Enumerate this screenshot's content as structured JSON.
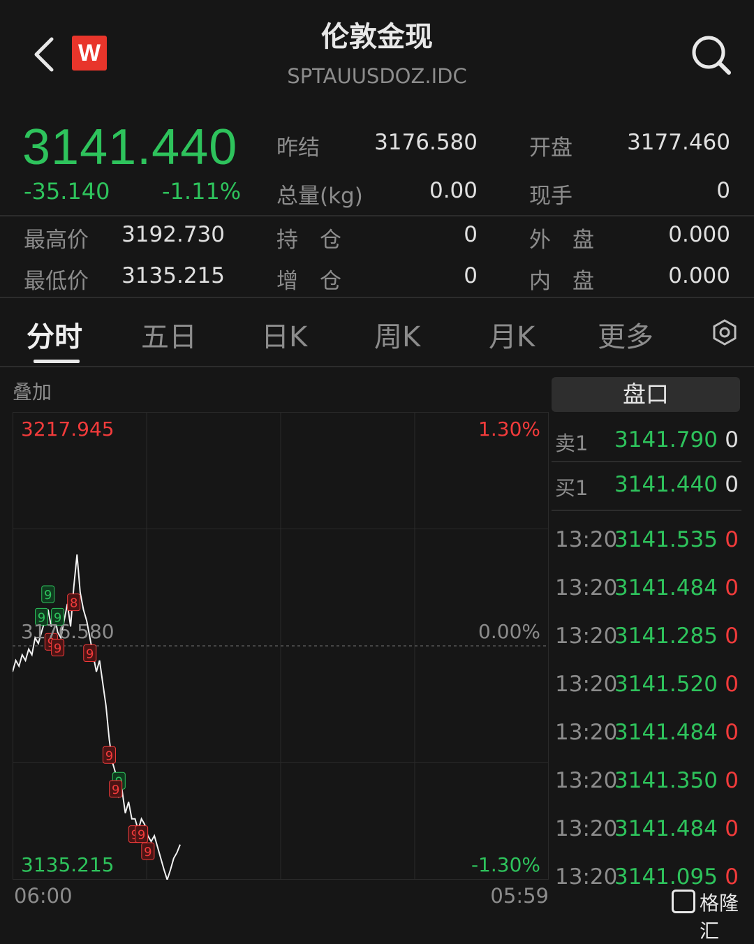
{
  "header": {
    "title": "伦敦金现",
    "code": "SPTAUUSDOZ.IDC",
    "logo_letter": "W"
  },
  "quote": {
    "price": "3141.440",
    "change": "-35.140",
    "change_pct": "-1.11%",
    "stats": [
      {
        "label": "昨结",
        "value": "3176.580"
      },
      {
        "label": "开盘",
        "value": "3177.460"
      },
      {
        "label": "总量(kg)",
        "value": "0.00"
      },
      {
        "label": "现手",
        "value": "0"
      },
      {
        "label": "最高价",
        "value": "3192.730"
      },
      {
        "label": "持　仓",
        "value": "0"
      },
      {
        "label": "外　盘",
        "value": "0.000"
      },
      {
        "label": "最低价",
        "value": "3135.215"
      },
      {
        "label": "增　仓",
        "value": "0"
      },
      {
        "label": "内　盘",
        "value": "0.000"
      }
    ]
  },
  "tabs": [
    "分时",
    "五日",
    "日K",
    "周K",
    "月K",
    "更多"
  ],
  "active_tab": "分时",
  "chart": {
    "overlay_label": "叠加",
    "high_label": "3217.945",
    "high_pct": "1.30%",
    "mid_label": "3176.580",
    "mid_pct": "0.00%",
    "low_label": "3135.215",
    "low_pct": "-1.30%",
    "time_start": "06:00",
    "time_end": "05:59"
  },
  "chart_data": {
    "type": "line",
    "title": "",
    "xlabel": "",
    "ylabel": "",
    "ylim": [
      3135.215,
      3217.945
    ],
    "reference": 3176.58,
    "x_range": [
      "06:00",
      "05:59"
    ],
    "y": [
      3172,
      3174,
      3173,
      3175,
      3174,
      3176,
      3175,
      3178,
      3177,
      3179,
      3181,
      3183,
      3180,
      3182,
      3179,
      3178,
      3181,
      3184,
      3180,
      3187,
      3192.73,
      3186,
      3183,
      3181,
      3178,
      3175,
      3172,
      3174,
      3170,
      3166,
      3160,
      3156,
      3154,
      3150,
      3151,
      3147,
      3149,
      3146,
      3146,
      3144,
      3146,
      3145,
      3143,
      3142,
      3143,
      3141,
      3139,
      3137,
      3135.215,
      3137,
      3139,
      3140,
      3141.44
    ]
  },
  "markers": [
    {
      "label": "9",
      "color": "green"
    },
    {
      "label": "9",
      "color": "green"
    },
    {
      "label": "9",
      "color": "green"
    },
    {
      "label": "9",
      "color": "red"
    },
    {
      "label": "9",
      "color": "red"
    },
    {
      "label": "8",
      "color": "red"
    },
    {
      "label": "9",
      "color": "red"
    },
    {
      "label": "9",
      "color": "red"
    },
    {
      "label": "9",
      "color": "green"
    },
    {
      "label": "9",
      "color": "red"
    },
    {
      "label": "9",
      "color": "red"
    },
    {
      "label": "9",
      "color": "red"
    },
    {
      "label": "9",
      "color": "red"
    },
    {
      "label": "9",
      "color": "red"
    }
  ],
  "orderbook": {
    "title": "盘口",
    "asks": [
      {
        "label": "卖1",
        "price": "3141.790",
        "qty": "0"
      }
    ],
    "bids": [
      {
        "label": "买1",
        "price": "3141.440",
        "qty": "0"
      }
    ]
  },
  "trades": [
    {
      "time": "13:20",
      "price": "3141.535",
      "qty": "0"
    },
    {
      "time": "13:20",
      "price": "3141.484",
      "qty": "0"
    },
    {
      "time": "13:20",
      "price": "3141.285",
      "qty": "0"
    },
    {
      "time": "13:20",
      "price": "3141.520",
      "qty": "0"
    },
    {
      "time": "13:20",
      "price": "3141.484",
      "qty": "0"
    },
    {
      "time": "13:20",
      "price": "3141.350",
      "qty": "0"
    },
    {
      "time": "13:20",
      "price": "3141.484",
      "qty": "0"
    },
    {
      "time": "13:20",
      "price": "3141.095",
      "qty": "0"
    }
  ],
  "watermark": "格隆汇",
  "colors": {
    "up": "#f23b3b",
    "down": "#2ec35c",
    "background": "#161616"
  }
}
